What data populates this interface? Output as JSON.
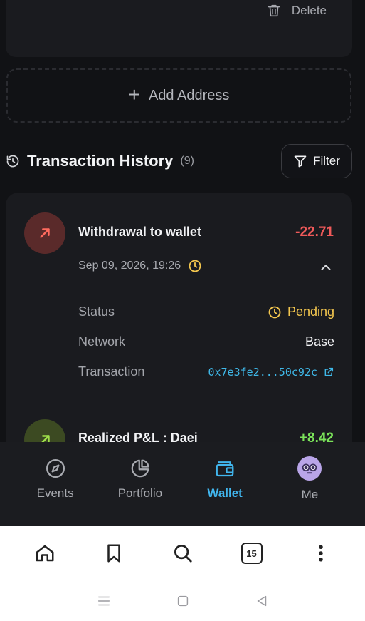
{
  "address_card": {
    "delete_label": "Delete"
  },
  "add_address": {
    "label": "Add Address"
  },
  "history": {
    "title": "Transaction History",
    "count": "(9)",
    "filter_label": "Filter"
  },
  "transactions": [
    {
      "title": "Withdrawal to wallet",
      "amount": "-22.71",
      "date": "Sep 09, 2026, 19:26",
      "details": {
        "status_label": "Status",
        "status_value": "Pending",
        "network_label": "Network",
        "network_value": "Base",
        "transaction_label": "Transaction",
        "transaction_value": "0x7e3fe2...50c92c"
      }
    },
    {
      "title": "Realized P&L : Daei",
      "amount": "+8.42"
    }
  ],
  "tabs": [
    {
      "label": "Events",
      "icon": "compass-icon"
    },
    {
      "label": "Portfolio",
      "icon": "pie-chart-icon"
    },
    {
      "label": "Wallet",
      "icon": "wallet-icon"
    },
    {
      "label": "Me",
      "icon": "avatar-icon"
    }
  ],
  "browser": {
    "tab_count": "15"
  },
  "colors": {
    "accent": "#41b6ee",
    "negative": "#ef5a5a",
    "positive": "#7be35a",
    "pending": "#f3c64e"
  }
}
